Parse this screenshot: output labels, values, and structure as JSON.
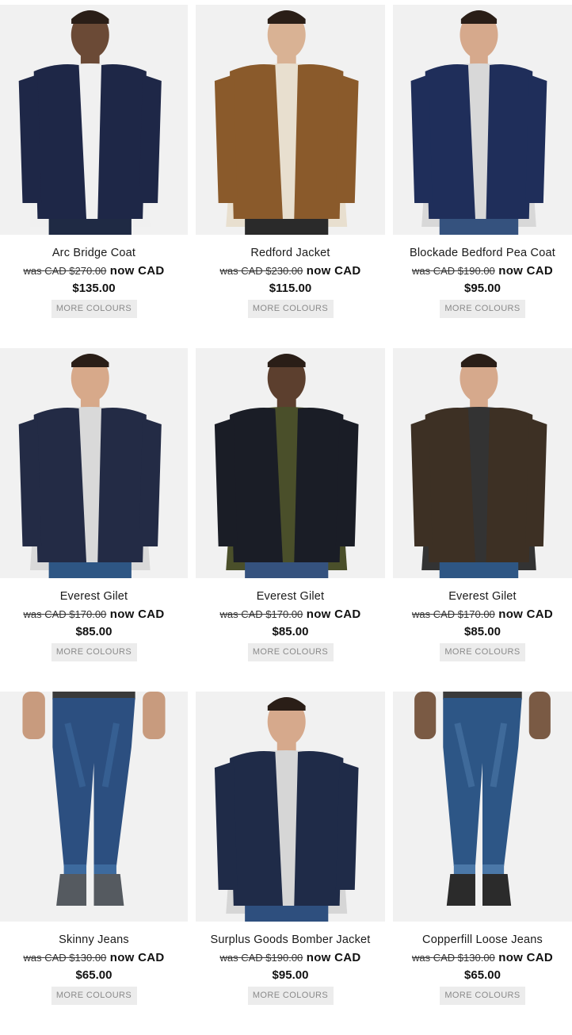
{
  "labels": {
    "was": "was",
    "now": "now CAD",
    "more_colours": "MORE COLOURS"
  },
  "products": [
    {
      "name": "Arc Bridge Coat",
      "was_price": "CAD $270.00",
      "now_price": "$135.00",
      "icon": "navy-peacoat-photo",
      "colors": {
        "garment": "#1e2747",
        "inner": "#f0f0f0",
        "skin": "#6b4a36",
        "legs": "#1f2a44"
      }
    },
    {
      "name": "Redford Jacket",
      "was_price": "CAD $230.00",
      "now_price": "$115.00",
      "icon": "tan-quilted-jacket-photo",
      "colors": {
        "garment": "#8a5a2b",
        "inner": "#e8dfcf",
        "skin": "#d9b294",
        "legs": "#2a2a2a"
      }
    },
    {
      "name": "Blockade Bedford Pea Coat",
      "was_price": "CAD $190.00",
      "now_price": "$95.00",
      "icon": "navy-pea-coat-photo",
      "colors": {
        "garment": "#1f2e5a",
        "inner": "#d8d8d8",
        "skin": "#d6a98c",
        "legs": "#35527e"
      }
    },
    {
      "name": "Everest Gilet",
      "was_price": "CAD $170.00",
      "now_price": "$85.00",
      "icon": "navy-gilet-photo",
      "colors": {
        "garment": "#232b45",
        "inner": "#d9d9d9",
        "skin": "#d7a98a",
        "legs": "#2e5684"
      }
    },
    {
      "name": "Everest Gilet",
      "was_price": "CAD $170.00",
      "now_price": "$85.00",
      "icon": "black-gilet-photo",
      "colors": {
        "garment": "#1a1d26",
        "inner": "#4a4f2a",
        "skin": "#5c3f2e",
        "legs": "#35527e"
      }
    },
    {
      "name": "Everest Gilet",
      "was_price": "CAD $170.00",
      "now_price": "$85.00",
      "icon": "brown-gilet-photo",
      "colors": {
        "garment": "#3d3024",
        "inner": "#333333",
        "skin": "#d6a98c",
        "legs": "#2e5684"
      }
    },
    {
      "name": "Skinny Jeans",
      "was_price": "CAD $130.00",
      "now_price": "$65.00",
      "icon": "blue-jeans-photo",
      "colors": {
        "garment": "#2c4f80",
        "inner": "#3d6a9e",
        "skin": "#c89b7e",
        "legs": "#555a60"
      }
    },
    {
      "name": "Surplus Goods Bomber Jacket",
      "was_price": "CAD $190.00",
      "now_price": "$95.00",
      "icon": "navy-bomber-jacket-photo",
      "colors": {
        "garment": "#1f2b48",
        "inner": "#d6d6d6",
        "skin": "#d6a98c",
        "legs": "#2e4f7e"
      }
    },
    {
      "name": "Copperfill Loose Jeans",
      "was_price": "CAD $130.00",
      "now_price": "$65.00",
      "icon": "distressed-jeans-photo",
      "colors": {
        "garment": "#2d5686",
        "inner": "#4b78a8",
        "skin": "#7a5a44",
        "legs": "#2b2b2b"
      }
    }
  ]
}
